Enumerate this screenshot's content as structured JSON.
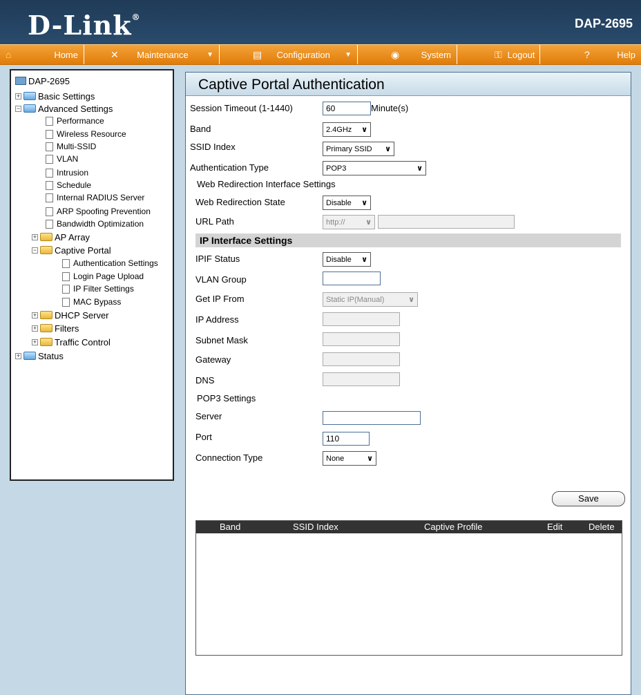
{
  "header": {
    "brand": "D-Link",
    "model": "DAP-2695"
  },
  "menu": [
    {
      "label": "Home",
      "icon": "home-icon",
      "caret": ""
    },
    {
      "label": "Maintenance",
      "icon": "tools-icon",
      "caret": "▼"
    },
    {
      "label": "Configuration",
      "icon": "config-icon",
      "caret": "▼"
    },
    {
      "label": "System",
      "icon": "system-icon",
      "caret": ""
    },
    {
      "label": "Logout",
      "icon": "logout-icon",
      "caret": ""
    },
    {
      "label": "Help",
      "icon": "help-icon",
      "caret": ""
    }
  ],
  "tree": {
    "root": "DAP-2695",
    "basic": "Basic Settings",
    "advanced": "Advanced Settings",
    "performance": "Performance",
    "wireless_resource": "Wireless Resource",
    "multi_ssid": "Multi-SSID",
    "vlan": "VLAN",
    "intrusion": "Intrusion",
    "schedule": "Schedule",
    "radius": "Internal RADIUS Server",
    "arp": "ARP Spoofing Prevention",
    "bandwidth": "Bandwidth Optimization",
    "ap_array": "AP Array",
    "captive_portal": "Captive Portal",
    "auth_settings": "Authentication Settings",
    "login_upload": "Login Page Upload",
    "ip_filter": "IP Filter Settings",
    "mac_bypass": "MAC Bypass",
    "dhcp": "DHCP Server",
    "filters": "Filters",
    "traffic": "Traffic Control",
    "status": "Status",
    "expand": "+",
    "collapse": "−"
  },
  "page": {
    "title": "Captive Portal Authentication",
    "session_timeout_label": "Session Timeout (1-1440)",
    "session_timeout_value": "60",
    "session_timeout_unit": "Minute(s)",
    "band_label": "Band",
    "band_value": "2.4GHz",
    "ssid_index_label": "SSID Index",
    "ssid_index_value": "Primary SSID",
    "auth_type_label": "Authentication Type",
    "auth_type_value": "POP3",
    "web_redirect_section": "Web Redirection Interface Settings",
    "web_redirect_state_label": "Web Redirection State",
    "web_redirect_state_value": "Disable",
    "url_path_label": "URL Path",
    "url_path_scheme": "http://",
    "url_path_value": "",
    "ip_interface_section": "IP Interface Settings",
    "ipif_status_label": "IPIF Status",
    "ipif_status_value": "Disable",
    "vlan_group_label": "VLAN Group",
    "vlan_group_value": "",
    "get_ip_from_label": "Get IP From",
    "get_ip_from_value": "Static IP(Manual)",
    "ip_address_label": "IP Address",
    "ip_address_value": "",
    "subnet_mask_label": "Subnet Mask",
    "subnet_mask_value": "",
    "gateway_label": "Gateway",
    "gateway_value": "",
    "dns_label": "DNS",
    "dns_value": "",
    "pop3_section": "POP3 Settings",
    "server_label": "Server",
    "server_value": "",
    "port_label": "Port",
    "port_value": "110",
    "connection_type_label": "Connection Type",
    "connection_type_value": "None",
    "save_label": "Save",
    "chevron": "∨"
  },
  "table": {
    "columns": [
      "Band",
      "SSID Index",
      "Captive Profile",
      "Edit",
      "Delete"
    ],
    "rows": []
  },
  "colors": {
    "header": "#1f3b57",
    "menu": "#e07c0a",
    "sidebar_bg": "#c4d8e6"
  }
}
